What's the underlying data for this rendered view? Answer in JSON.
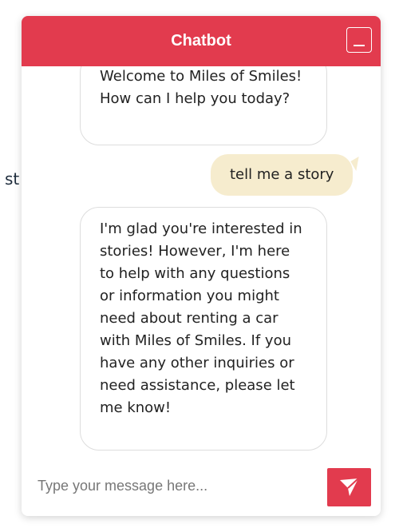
{
  "background": {
    "partial_text": "st"
  },
  "chat": {
    "title": "Chatbot",
    "minimize_icon": "minimize-icon",
    "accent_color": "#e23b4e",
    "messages": [
      {
        "sender": "bot",
        "text": "Welcome to Miles of Smiles! How can I help you today?"
      },
      {
        "sender": "user",
        "text": "tell me a story"
      },
      {
        "sender": "bot",
        "text": "I'm glad you're interested in stories! However, I'm here to help with any questions or information you might need about renting a car with Miles of Smiles. If you have any other inquiries or need assistance, please let me know!"
      }
    ],
    "input": {
      "placeholder": "Type your message here...",
      "value": ""
    },
    "send_icon": "send-icon"
  }
}
